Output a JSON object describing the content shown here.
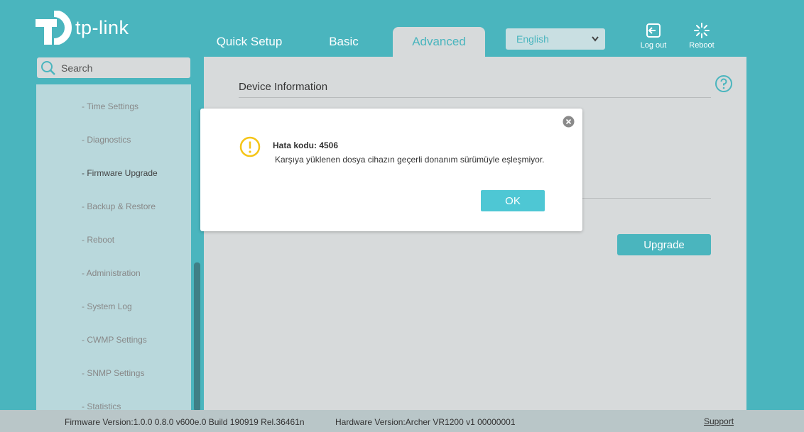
{
  "brand": {
    "logo_text": "tp-link"
  },
  "tabs": [
    {
      "label": "Quick Setup"
    },
    {
      "label": "Basic"
    },
    {
      "label": "Advanced"
    }
  ],
  "language": {
    "selected": "English"
  },
  "header_buttons": {
    "logout_label": "Log out",
    "reboot_label": "Reboot"
  },
  "search": {
    "placeholder": "Search"
  },
  "sidebar": {
    "items": [
      {
        "label": "- Time Settings"
      },
      {
        "label": "- Diagnostics"
      },
      {
        "label": "- Firmware Upgrade"
      },
      {
        "label": "- Backup & Restore"
      },
      {
        "label": "- Reboot"
      },
      {
        "label": "- Administration"
      },
      {
        "label": "- System Log"
      },
      {
        "label": "- CWMP Settings"
      },
      {
        "label": "- SNMP Settings"
      },
      {
        "label": "- Statistics"
      }
    ]
  },
  "main": {
    "section_title": "Device Information",
    "upgrade_label": "Upgrade"
  },
  "modal": {
    "error_title": "Hata kodu: 4506",
    "error_message": "Karşıya yüklenen dosya cihazın geçerli donanım sürümüyle eşleşmiyor.",
    "ok_label": "OK"
  },
  "footer": {
    "firmware": "Firmware Version:1.0.0 0.8.0 v600e.0 Build 190919 Rel.36461n",
    "hardware": "Hardware Version:Archer VR1200 v1 00000001",
    "support": "Support"
  },
  "colors": {
    "accent": "#4ab5be",
    "panel": "#d7dadb",
    "warning": "#f5c518"
  }
}
